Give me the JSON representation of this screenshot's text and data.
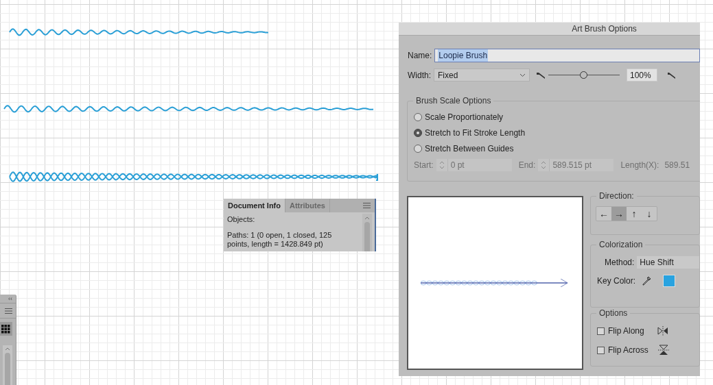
{
  "dialog": {
    "title": "Art Brush Options",
    "name": {
      "label": "Name:",
      "value": "Loopie Brush",
      "selected": true
    },
    "width": {
      "label": "Width:",
      "value": "Fixed",
      "level": 0.5,
      "percent": "100%"
    },
    "brush_scale": {
      "title": "Brush Scale Options",
      "options": [
        {
          "label": "Scale Proportionately",
          "selected": false
        },
        {
          "label": "Stretch to Fit Stroke Length",
          "selected": true
        },
        {
          "label": "Stretch Between Guides",
          "selected": false
        }
      ],
      "start_label": "Start:",
      "start_value": "0 pt",
      "end_label": "End:",
      "end_value": "589.515 pt",
      "length_label": "Length(X):",
      "length_value": "589.51",
      "disabled": true
    },
    "direction": {
      "title": "Direction:",
      "buttons": [
        {
          "symbol": "←",
          "selected": false
        },
        {
          "symbol": "→",
          "selected": true
        },
        {
          "symbol": "↑",
          "selected": false
        },
        {
          "symbol": "↓",
          "selected": false
        }
      ]
    },
    "colorization": {
      "title": "Colorization",
      "method_label": "Method:",
      "method_value": "Hue Shift",
      "key_color_label": "Key Color:",
      "key_color_swatch": {
        "color": "#29a3e0"
      }
    },
    "options": {
      "title": "Options",
      "checkboxes": [
        {
          "label": "Flip Along",
          "checked": false,
          "kind": "along"
        },
        {
          "label": "Flip Across",
          "checked": false,
          "kind": "across"
        }
      ]
    }
  },
  "doc_info": {
    "tabs": [
      {
        "label": "Document Info",
        "selected": true
      },
      {
        "label": "Attributes",
        "selected": false
      }
    ],
    "lines": [
      "Objects:",
      "Paths: 1 (0 open, 1 closed, 125 points, length = 1428.849 pt)"
    ]
  },
  "tool_panel": {
    "collapse": "‹‹"
  }
}
